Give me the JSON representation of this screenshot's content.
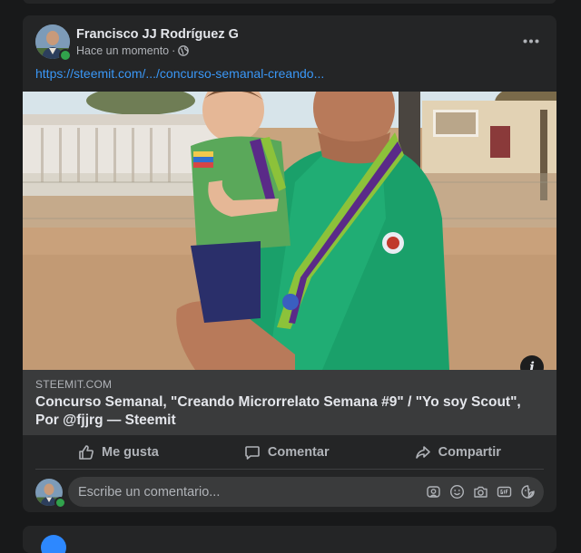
{
  "post": {
    "author": "Francisco JJ Rodríguez G",
    "timestamp": "Hace un momento",
    "separator": "·",
    "privacy_icon": "globe-icon",
    "link_text": "https://steemit.com/.../concurso-semanal-creando...",
    "more_icon": "more-dots-icon"
  },
  "link_preview": {
    "domain": "STEEMIT.COM",
    "title": "Concurso Semanal, \"Creando Microrrelato Semana #9\" / \"Yo soy Scout\", Por @fjjrg — Steemit",
    "info_icon_glyph": "i"
  },
  "actions": {
    "like_label": "Me gusta",
    "comment_label": "Comentar",
    "share_label": "Compartir"
  },
  "comment": {
    "placeholder": "Escribe un comentario..."
  },
  "colors": {
    "background": "#18191a",
    "card": "#242526",
    "link": "#3a97f6",
    "online": "#31a24c",
    "secondary_text": "#b0b3b8"
  }
}
